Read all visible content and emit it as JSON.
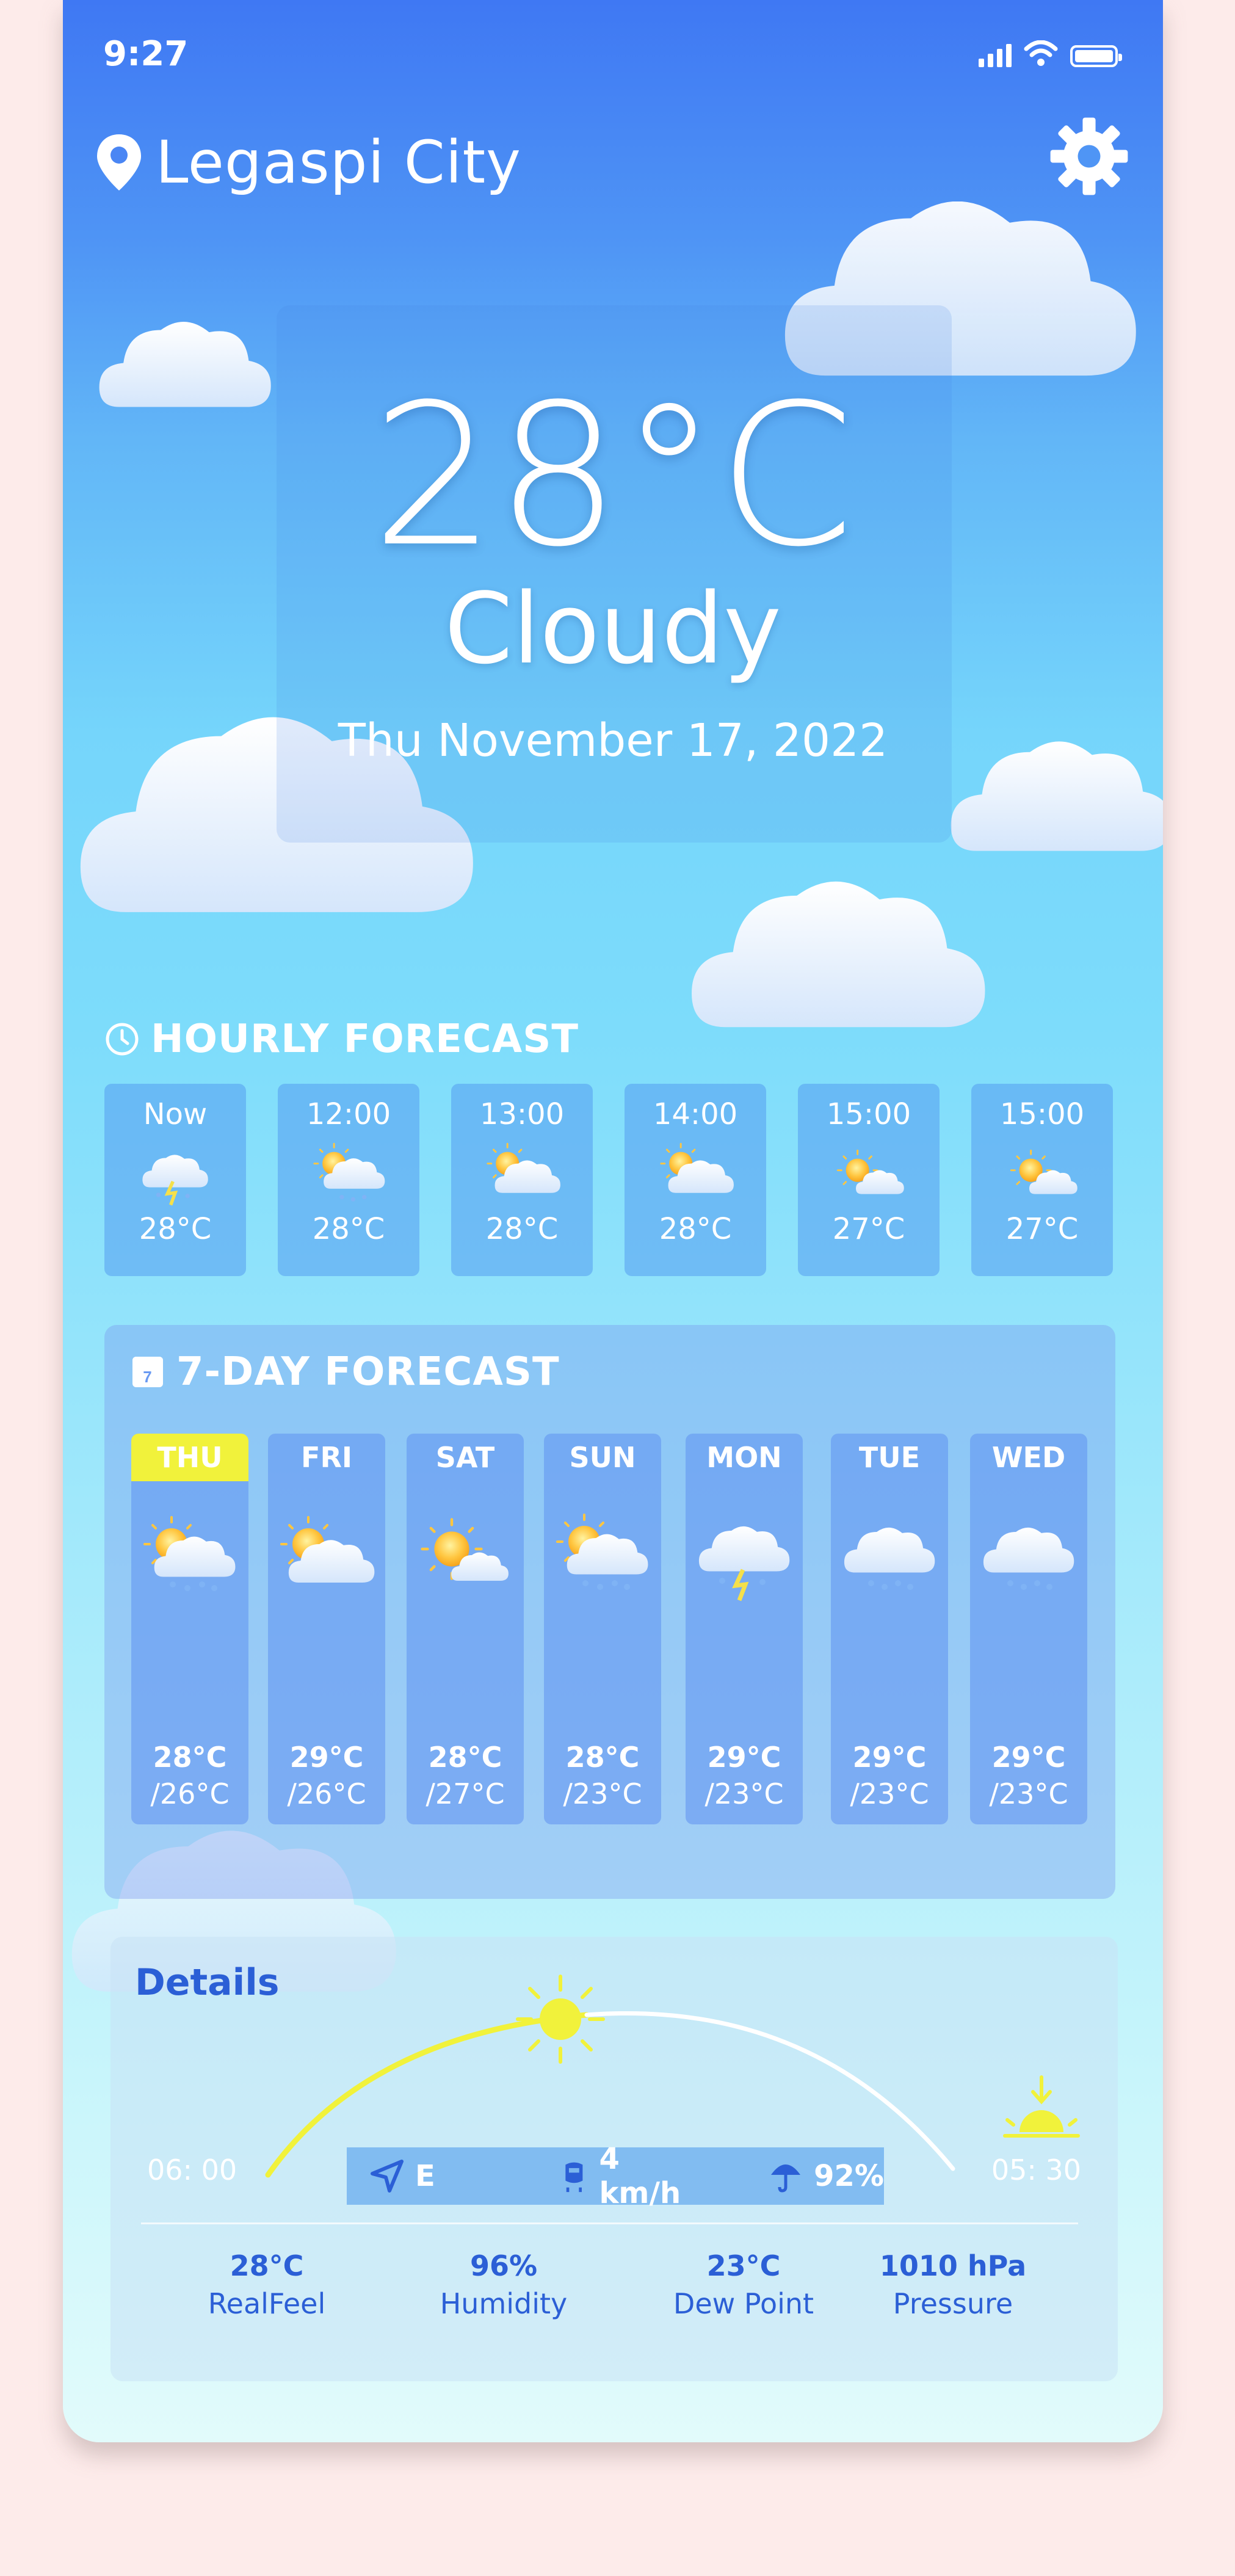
{
  "status": {
    "time": "9:27"
  },
  "header": {
    "location": "Legaspi City"
  },
  "current": {
    "temperature": "28°C",
    "condition": "Cloudy",
    "date": "Thu November 17, 2022"
  },
  "hourly": {
    "title": "HOURLY FORECAST",
    "items": [
      {
        "time": "Now",
        "temp": "28°C",
        "icon": "cloud-rain-lightning-icon"
      },
      {
        "time": "12:00",
        "temp": "28°C",
        "icon": "partly-cloudy-rain-icon"
      },
      {
        "time": "13:00",
        "temp": "28°C",
        "icon": "partly-cloudy-icon"
      },
      {
        "time": "14:00",
        "temp": "28°C",
        "icon": "partly-cloudy-icon"
      },
      {
        "time": "15:00",
        "temp": "27°C",
        "icon": "partly-cloudy-icon"
      },
      {
        "time": "15:00",
        "temp": "27°C",
        "icon": "partly-cloudy-icon"
      }
    ]
  },
  "weekly": {
    "title": "7-DAY FORECAST",
    "calendar_day": "7",
    "days": [
      {
        "day": "THU",
        "high": "28°C",
        "low": "/26°C",
        "icon": "partly-cloudy-rain-icon"
      },
      {
        "day": "FRI",
        "high": "29°C",
        "low": "/26°C",
        "icon": "partly-cloudy-icon"
      },
      {
        "day": "SAT",
        "high": "28°C",
        "low": "/27°C",
        "icon": "partly-cloudy-icon"
      },
      {
        "day": "SUN",
        "high": "28°C",
        "low": "/23°C",
        "icon": "partly-cloudy-rain-icon"
      },
      {
        "day": "MON",
        "high": "29°C",
        "low": "/23°C",
        "icon": "cloud-lightning-icon"
      },
      {
        "day": "TUE",
        "high": "29°C",
        "low": "/23°C",
        "icon": "cloud-rain-icon"
      },
      {
        "day": "WED",
        "high": "29°C",
        "low": "/23°C",
        "icon": "cloud-rain-icon"
      }
    ]
  },
  "details": {
    "title": "Details",
    "sunrise": "06: 00",
    "sunset": "05: 30",
    "wind_direction": "E",
    "wind_speed": "4 km/h",
    "rain_chance": "92%",
    "stats": [
      {
        "value": "28°C",
        "name": "RealFeel"
      },
      {
        "value": "96%",
        "name": "Humidity"
      },
      {
        "value": "23°C",
        "name": "Dew Point"
      },
      {
        "value": "1010 hPa",
        "name": "Pressure"
      }
    ]
  },
  "colors": {
    "sky_top": "#3f78f3",
    "sky_bottom": "#e2fbfb",
    "accent_yellow": "#f1f23b",
    "details_text": "#2b5fd6",
    "background": "#fdebea"
  }
}
